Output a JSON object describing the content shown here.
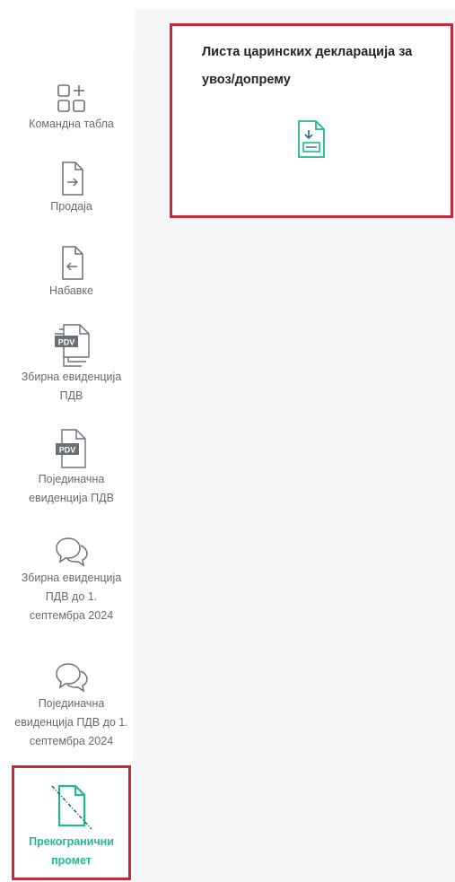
{
  "sidebar": {
    "items": [
      {
        "id": "dashboard",
        "label": "Командна табла",
        "icon": "dashboard-icon"
      },
      {
        "id": "sales",
        "label": "Продаја",
        "icon": "document-arrow-right-icon"
      },
      {
        "id": "purchases",
        "label": "Набавке",
        "icon": "document-arrow-left-icon"
      },
      {
        "id": "vat_summary",
        "label": "Збирна евиденција ПДВ",
        "icon": "pdv-stack-icon"
      },
      {
        "id": "vat_individual",
        "label": "Појединачна евиденција ПДВ",
        "icon": "pdv-document-icon"
      },
      {
        "id": "vat_summary_old",
        "label": "Збирна евиденција ПДВ до 1. септембра 2024",
        "icon": "chat-bubbles-icon"
      },
      {
        "id": "vat_individual_old",
        "label": "Појединачна евиденција ПДВ до 1. септембра 2024",
        "icon": "chat-bubbles-icon"
      },
      {
        "id": "cross_border",
        "label": "Прекогранични промет",
        "icon": "document-slash-icon",
        "active": true
      }
    ],
    "pdv_badge": "PDV"
  },
  "main": {
    "card": {
      "title": "Листа царинских декларација за увоз/допрему",
      "icon": "document-download-icon"
    }
  },
  "colors": {
    "accent": "#1fb993",
    "highlight_border": "#c42b38",
    "icon_gray": "#6b7078",
    "content_bg": "#f5f6f8"
  }
}
